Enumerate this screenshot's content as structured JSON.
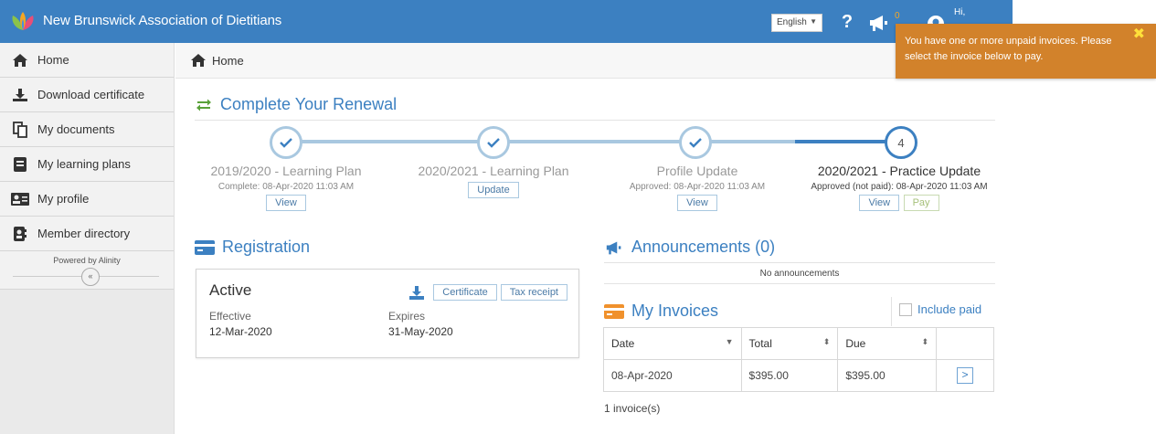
{
  "app": {
    "title": "New Brunswick Association of Dietitians"
  },
  "header": {
    "language": "English",
    "help": "?",
    "notification_count": "0",
    "greeting": "Hi,"
  },
  "toast": {
    "message": "You have one or more unpaid invoices. Please select the invoice below to pay."
  },
  "sidebar": {
    "items": [
      {
        "label": "Home",
        "icon": "home-icon"
      },
      {
        "label": "Download certificate",
        "icon": "download-icon"
      },
      {
        "label": "My documents",
        "icon": "documents-icon"
      },
      {
        "label": "My learning plans",
        "icon": "notebook-icon"
      },
      {
        "label": "My profile",
        "icon": "id-card-icon"
      },
      {
        "label": "Member directory",
        "icon": "address-book-icon"
      }
    ],
    "powered_by": "Powered by Alinity",
    "collapse": "«"
  },
  "breadcrumb": {
    "label": "Home"
  },
  "renewal": {
    "title": "Complete Your Renewal",
    "steps": [
      {
        "title": "2019/2020 - Learning Plan",
        "sub": "Complete: 08-Apr-2020 11:03 AM",
        "buttons": [
          "View"
        ]
      },
      {
        "title": "2020/2021 - Learning Plan",
        "sub": "",
        "buttons": [
          "Update"
        ]
      },
      {
        "title": "Profile Update",
        "sub": "Approved: 08-Apr-2020 11:03 AM",
        "buttons": [
          "View"
        ]
      },
      {
        "title": "2020/2021 - Practice Update",
        "sub": "Approved (not paid): 08-Apr-2020 11:03 AM",
        "buttons": [
          "View",
          "Pay"
        ],
        "number": "4"
      }
    ]
  },
  "registration": {
    "title": "Registration",
    "status": "Active",
    "certificate_label": "Certificate",
    "tax_receipt_label": "Tax receipt",
    "effective_label": "Effective",
    "effective_value": "12-Mar-2020",
    "expires_label": "Expires",
    "expires_value": "31-May-2020"
  },
  "announcements": {
    "title": "Announcements (0)",
    "empty": "No announcements"
  },
  "invoices": {
    "title": "My Invoices",
    "include_paid": "Include paid",
    "columns": [
      "Date",
      "Total",
      "Due"
    ],
    "rows": [
      {
        "date": "08-Apr-2020",
        "total": "$395.00",
        "due": "$395.00",
        "action": ">"
      }
    ],
    "count": "1 invoice(s)"
  },
  "colors": {
    "brand": "#3c80c1",
    "toast": "#d2822b",
    "accent_green": "#5aa13a",
    "invoice_orange": "#f0912c"
  }
}
